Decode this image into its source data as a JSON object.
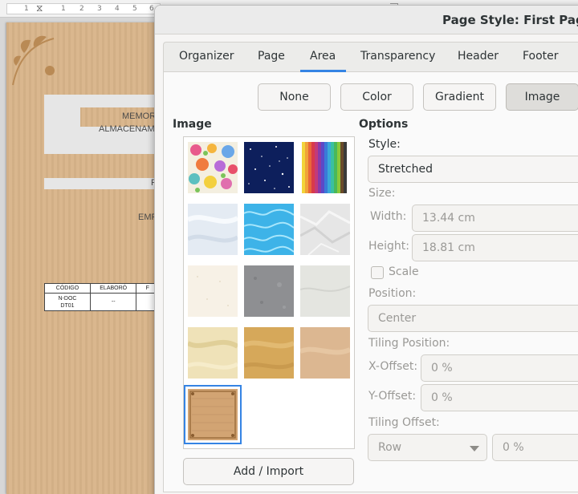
{
  "ruler": {
    "ticks": [
      "1",
      "1",
      "2",
      "3",
      "4",
      "5",
      "6"
    ]
  },
  "document": {
    "line1": "MEMOR",
    "line2": "ALMACENAM",
    "line3": "F",
    "line4": "EMP",
    "table": {
      "headers": [
        "CÓDIGO",
        "ELABORÓ",
        "F"
      ],
      "row": [
        "N-DOC\nDT01",
        "--",
        ""
      ]
    }
  },
  "dialog": {
    "title": "Page Style: First Page",
    "tabs": [
      "Organizer",
      "Page",
      "Area",
      "Transparency",
      "Header",
      "Footer"
    ],
    "active_tab": "Area",
    "fill_buttons": [
      "None",
      "Color",
      "Gradient",
      "Image"
    ],
    "active_fill": "Image",
    "image_section_label": "Image",
    "options_section_label": "Options",
    "style_label": "Style:",
    "style_value": "Stretched",
    "size_label": "Size:",
    "width_label": "Width:",
    "width_value": "13.44 cm",
    "height_label": "Height:",
    "height_value": "18.81 cm",
    "scale_label": "Scale",
    "position_label": "Position:",
    "position_value": "Center",
    "tiling_position_label": "Tiling Position:",
    "x_offset_label": "X-Offset:",
    "x_offset_value": "0 %",
    "y_offset_label": "Y-Offset:",
    "y_offset_value": "0 %",
    "tiling_offset_label": "Tiling Offset:",
    "tiling_offset_mode": "Row",
    "tiling_offset_value": "0 %",
    "add_import_label": "Add / Import"
  },
  "images": [
    "painted-flowers",
    "night-sky",
    "colored-pencils",
    "snow",
    "swimming-pool",
    "paper-crumpled",
    "paper",
    "concrete",
    "marble",
    "parchment",
    "sand",
    "paper-brown",
    "brown-frame"
  ],
  "selected_image": "brown-frame",
  "colors": {
    "accent": "#3584e4",
    "document_paper": "#d9b58a"
  }
}
